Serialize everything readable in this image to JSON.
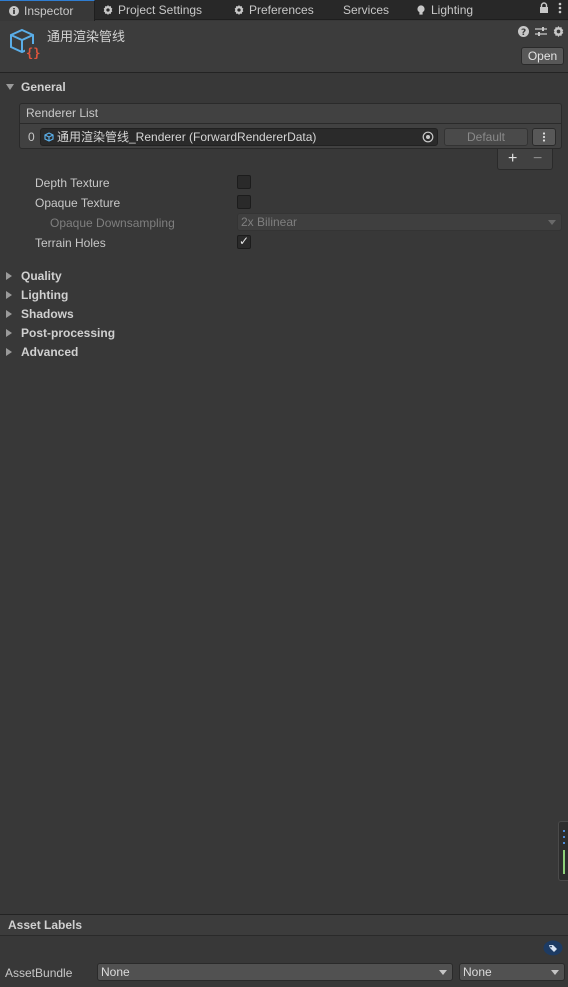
{
  "tabs": [
    {
      "label": "Inspector",
      "icon": "info-icon",
      "active": true
    },
    {
      "label": "Project Settings",
      "icon": "gear-icon"
    },
    {
      "label": "Preferences",
      "icon": "gear-icon"
    },
    {
      "label": "Services",
      "icon": ""
    },
    {
      "label": "Lighting",
      "icon": "lightbulb-icon"
    }
  ],
  "header": {
    "title": "通用渲染管线",
    "open_label": "Open"
  },
  "general": {
    "label": "General",
    "renderer_list": {
      "title": "Renderer List",
      "items": [
        {
          "index": "0",
          "value": "通用渲染管线_Renderer (ForwardRendererData)",
          "default_label": "Default"
        }
      ],
      "add_label": "+",
      "remove_label": "−"
    },
    "depth_texture": {
      "label": "Depth Texture",
      "checked": false
    },
    "opaque_texture": {
      "label": "Opaque Texture",
      "checked": false
    },
    "opaque_downsampling": {
      "label": "Opaque Downsampling",
      "value": "2x Bilinear"
    },
    "terrain_holes": {
      "label": "Terrain Holes",
      "checked": true,
      "mark": "✓"
    }
  },
  "sections": [
    "Quality",
    "Lighting",
    "Shadows",
    "Post-processing",
    "Advanced"
  ],
  "asset_labels": {
    "title": "Asset Labels",
    "assetbundle_label": "AssetBundle",
    "bundle_value": "None",
    "variant_value": "None"
  },
  "colors": {
    "accent": "#2f7dd1",
    "asset_icon": "#5aaee8",
    "asset_icon_braces": "#e0553c"
  }
}
